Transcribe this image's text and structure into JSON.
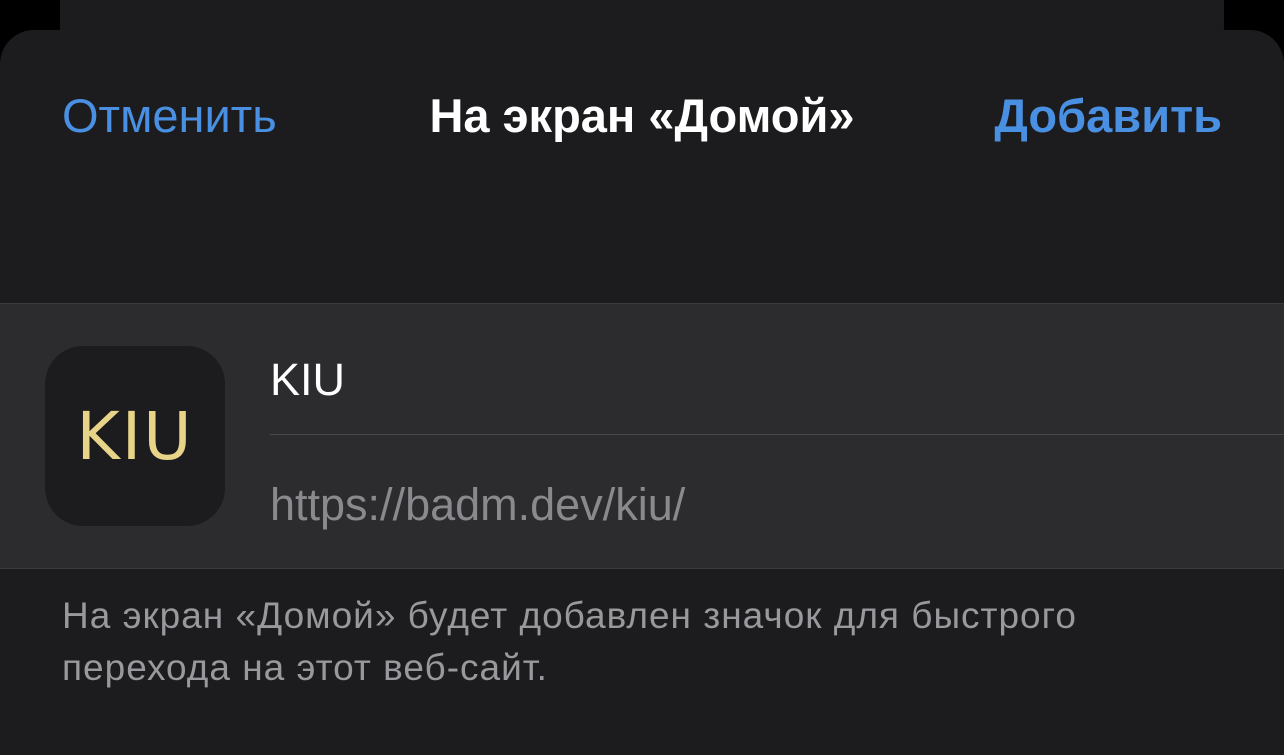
{
  "nav": {
    "cancel_label": "Отменить",
    "title": "На экран «Домой»",
    "add_label": "Добавить"
  },
  "bookmark": {
    "icon_text": "KIU",
    "name": "KIU",
    "url": "https://badm.dev/kiu/"
  },
  "footnote": {
    "line1": "На экран «Домой» будет добавлен значок для быстрого",
    "line2": "перехода на этот веб-сайт."
  },
  "colors": {
    "accent": "#4a90e2",
    "background": "#1c1c1e",
    "card": "#2c2c2e",
    "icon_text": "#e8d489"
  }
}
